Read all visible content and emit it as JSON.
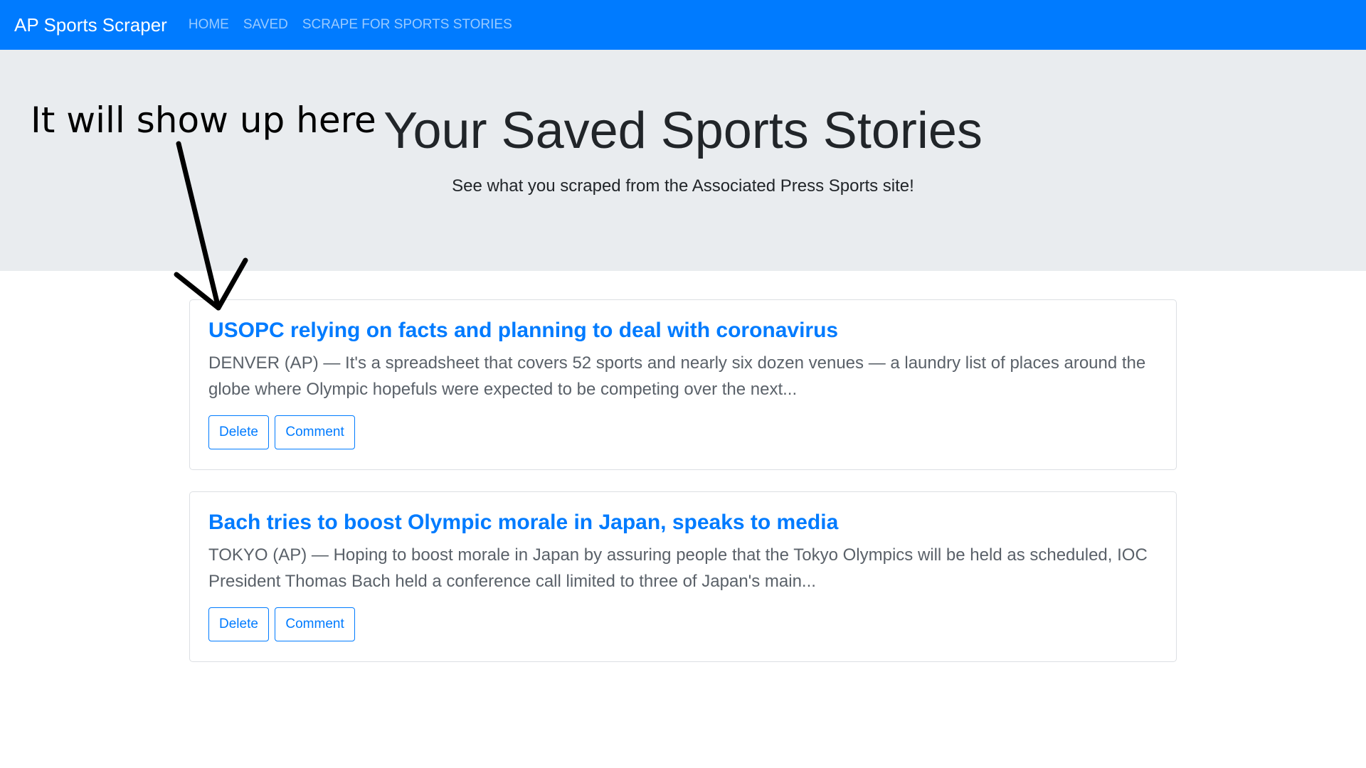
{
  "navbar": {
    "brand": "AP Sports Scraper",
    "links": [
      "HOME",
      "SAVED",
      "SCRAPE FOR SPORTS STORIES"
    ],
    "color": "#007bff"
  },
  "jumbotron": {
    "title": "Your Saved Sports Stories",
    "lead": "See what you scraped from the Associated Press Sports site!",
    "background": "#e9ecef"
  },
  "annotation": {
    "text": "It will show up here",
    "icon": "arrow-down-icon"
  },
  "articles": [
    {
      "title": "USOPC relying on facts and planning to deal with coronavirus",
      "summary": "DENVER (AP) — It's a spreadsheet that covers 52 sports and nearly six dozen venues — a laundry list of places around the globe where Olympic hopefuls were expected to be competing over the next...",
      "delete_label": "Delete",
      "comment_label": "Comment"
    },
    {
      "title": "Bach tries to boost Olympic morale in Japan, speaks to media",
      "summary": "TOKYO (AP) — Hoping to boost morale in Japan by assuring people that the Tokyo Olympics will be held as scheduled, IOC President Thomas Bach held a conference call limited to three of Japan's main...",
      "delete_label": "Delete",
      "comment_label": "Comment"
    }
  ]
}
